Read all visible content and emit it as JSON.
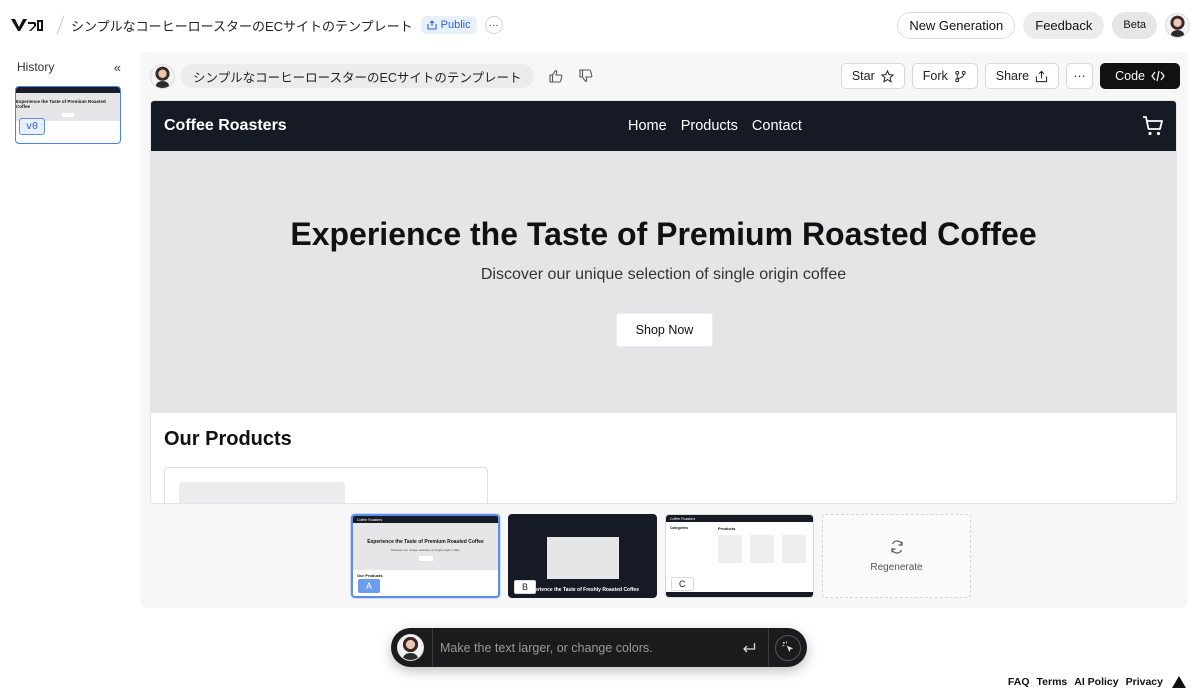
{
  "header": {
    "project_title": "シンプルなコーヒーロースターのECサイトのテンプレート",
    "visibility": "Public",
    "more": "···",
    "new_generation": "New Generation",
    "feedback": "Feedback",
    "beta": "Beta"
  },
  "history": {
    "title": "History",
    "collapse": "«",
    "version": "v0"
  },
  "toolbar": {
    "prompt": "シンプルなコーヒーロースターのECサイトのテンプレート",
    "star": "Star",
    "fork": "Fork",
    "share": "Share",
    "more": "···",
    "code": "Code"
  },
  "preview": {
    "brand": "Coffee Roasters",
    "nav": [
      "Home",
      "Products",
      "Contact"
    ],
    "hero_title": "Experience the Taste of Premium Roasted Coffee",
    "hero_subtitle": "Discover our unique selection of single origin coffee",
    "hero_button": "Shop Now",
    "products_heading": "Our Products"
  },
  "variants": [
    {
      "tag": "A",
      "title": "Experience the Taste of Premium Roasted Coffee",
      "subtitle": "Discover our unique selection of single origin coffee",
      "section": "Our Products"
    },
    {
      "tag": "B",
      "title": "Experience the Taste of Freshly Roasted Coffee"
    },
    {
      "tag": "C",
      "brand": "Coffee Roasters",
      "section": "Products",
      "categories_label": "Categories"
    }
  ],
  "regenerate": "Regenerate",
  "chat": {
    "placeholder": "Make the text larger, or change colors."
  },
  "footer": {
    "links": [
      "FAQ",
      "Terms",
      "AI Policy",
      "Privacy"
    ]
  },
  "colors": {
    "accent": "#5b8de9",
    "site_nav": "#161a25",
    "hero_bg": "#e5e5e8",
    "code_button": "#111111"
  }
}
